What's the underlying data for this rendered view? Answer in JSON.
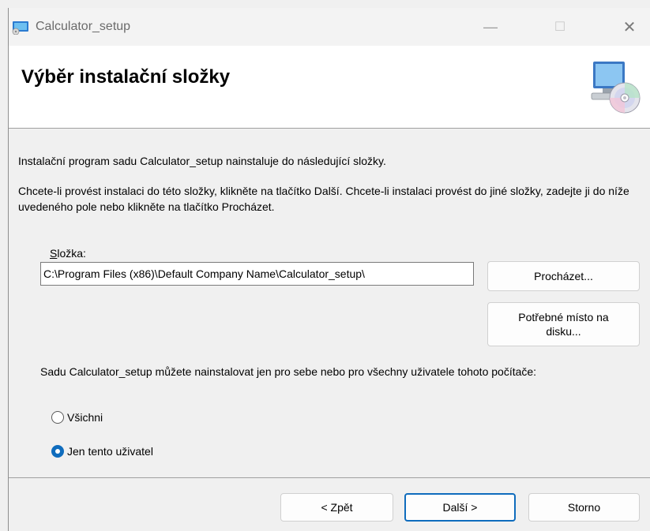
{
  "window": {
    "title": "Calculator_setup",
    "minimize_symbol": "—",
    "maximize_symbol": "☐",
    "close_symbol": "✕",
    "icon": "installer-app-icon"
  },
  "header": {
    "title": "Výběr instalační složky",
    "art_icon": "computer-cd-icon"
  },
  "body": {
    "intro": "Instalační program sadu Calculator_setup nainstaluje do následující složky.",
    "instructions": "Chcete-li provést instalaci do této složky, klikněte na tlačítko Další. Chcete-li instalaci provést do jiné složky, zadejte ji do níže uvedeného pole nebo klikněte na tlačítko Procházet.",
    "folder_label_first": "S",
    "folder_label_rest": "ložka:",
    "folder_path": "C:\\Program Files (x86)\\Default Company Name\\Calculator_setup\\",
    "browse_label": "Procházet...",
    "disk_cost_label": "Potřebné místo na disku...",
    "scope_text": "Sadu Calculator_setup můžete nainstalovat jen pro sebe nebo pro všechny uživatele tohoto počítače:",
    "options": [
      {
        "label": "Všichni",
        "selected": false
      },
      {
        "label": "Jen tento uživatel",
        "selected": true
      }
    ]
  },
  "footer": {
    "back_label": "< Zpět",
    "next_label": "Další >",
    "cancel_label": "Storno"
  },
  "colors": {
    "accent": "#0f6cbd",
    "dialog_bg": "#f0f0f0",
    "header_bg": "#ffffff"
  }
}
